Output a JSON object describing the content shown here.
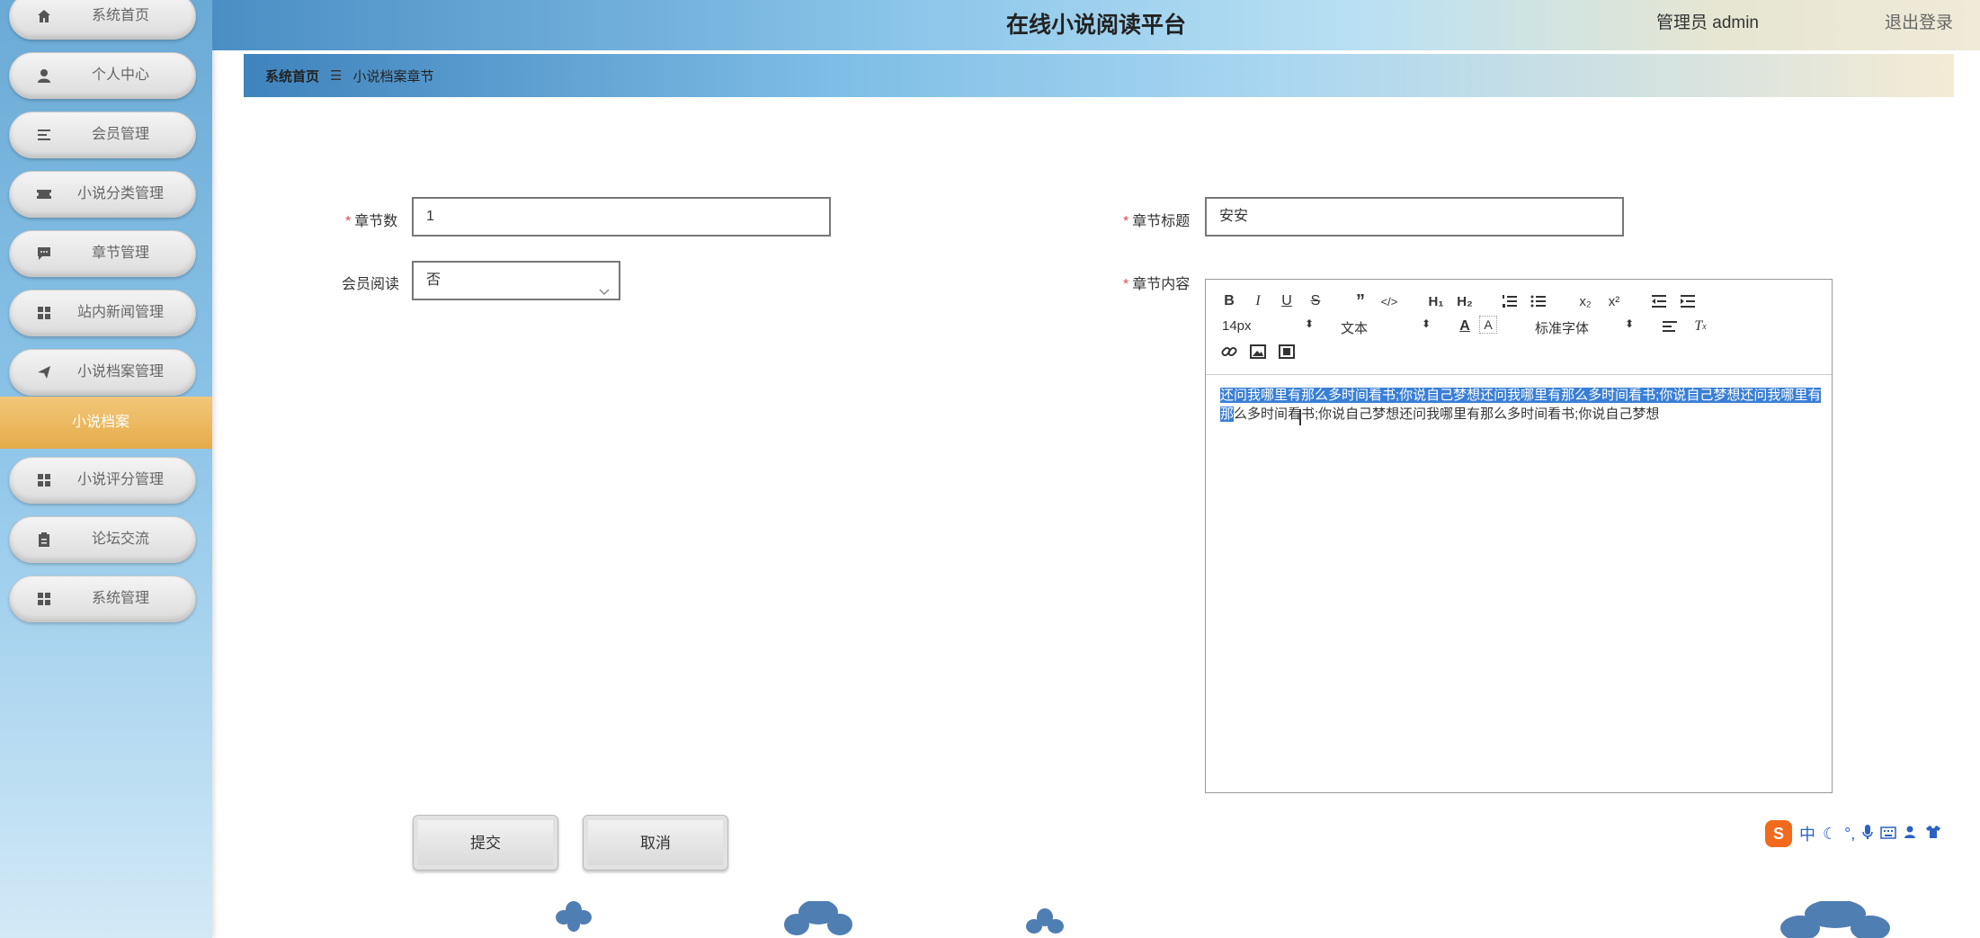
{
  "sidebar": {
    "items": [
      {
        "label": "系统首页",
        "icon": "home-icon"
      },
      {
        "label": "个人中心",
        "icon": "user-icon"
      },
      {
        "label": "会员管理",
        "icon": "list-icon"
      },
      {
        "label": "小说分类管理",
        "icon": "ticket-icon"
      },
      {
        "label": "章节管理",
        "icon": "message-icon"
      },
      {
        "label": "站内新闻管理",
        "icon": "grid-icon"
      },
      {
        "label": "小说档案管理",
        "icon": "send-icon"
      },
      {
        "label": "小说评分管理",
        "icon": "grid-icon"
      },
      {
        "label": "论坛交流",
        "icon": "clipboard-icon"
      },
      {
        "label": "系统管理",
        "icon": "grid-icon"
      }
    ],
    "submenu_active": "小说档案"
  },
  "header": {
    "title": "在线小说阅读平台",
    "user": "管理员 admin",
    "logout": "退出登录"
  },
  "breadcrumb": {
    "home": "系统首页",
    "separator": "☰",
    "current": "小说档案章节"
  },
  "form": {
    "chapter_no": {
      "label": "章节数",
      "value": "1",
      "required": true
    },
    "chapter_title": {
      "label": "章节标题",
      "value": "安安",
      "required": true
    },
    "member_read": {
      "label": "会员阅读",
      "value": "否"
    },
    "chapter_content": {
      "label": "章节内容",
      "required": true
    }
  },
  "editor": {
    "font_size": "14px",
    "header_select": "文本",
    "font_select": "标准字体",
    "content_selected": "还问我哪里有那么多时间看书;你说自己梦想还问我哪里有那么多时间看书;你说自己梦想还问我哪里有那",
    "content_rest": "么多时间看书;你说自己梦想还问我哪里有那么多时间看书;你说自己梦想"
  },
  "buttons": {
    "submit": "提交",
    "cancel": "取消"
  },
  "ime": {
    "logo": "S",
    "mode": "中"
  },
  "colors": {
    "accent": "#3a7fd6",
    "required": "#e04b4b",
    "submenu": "#e6ac4a"
  }
}
